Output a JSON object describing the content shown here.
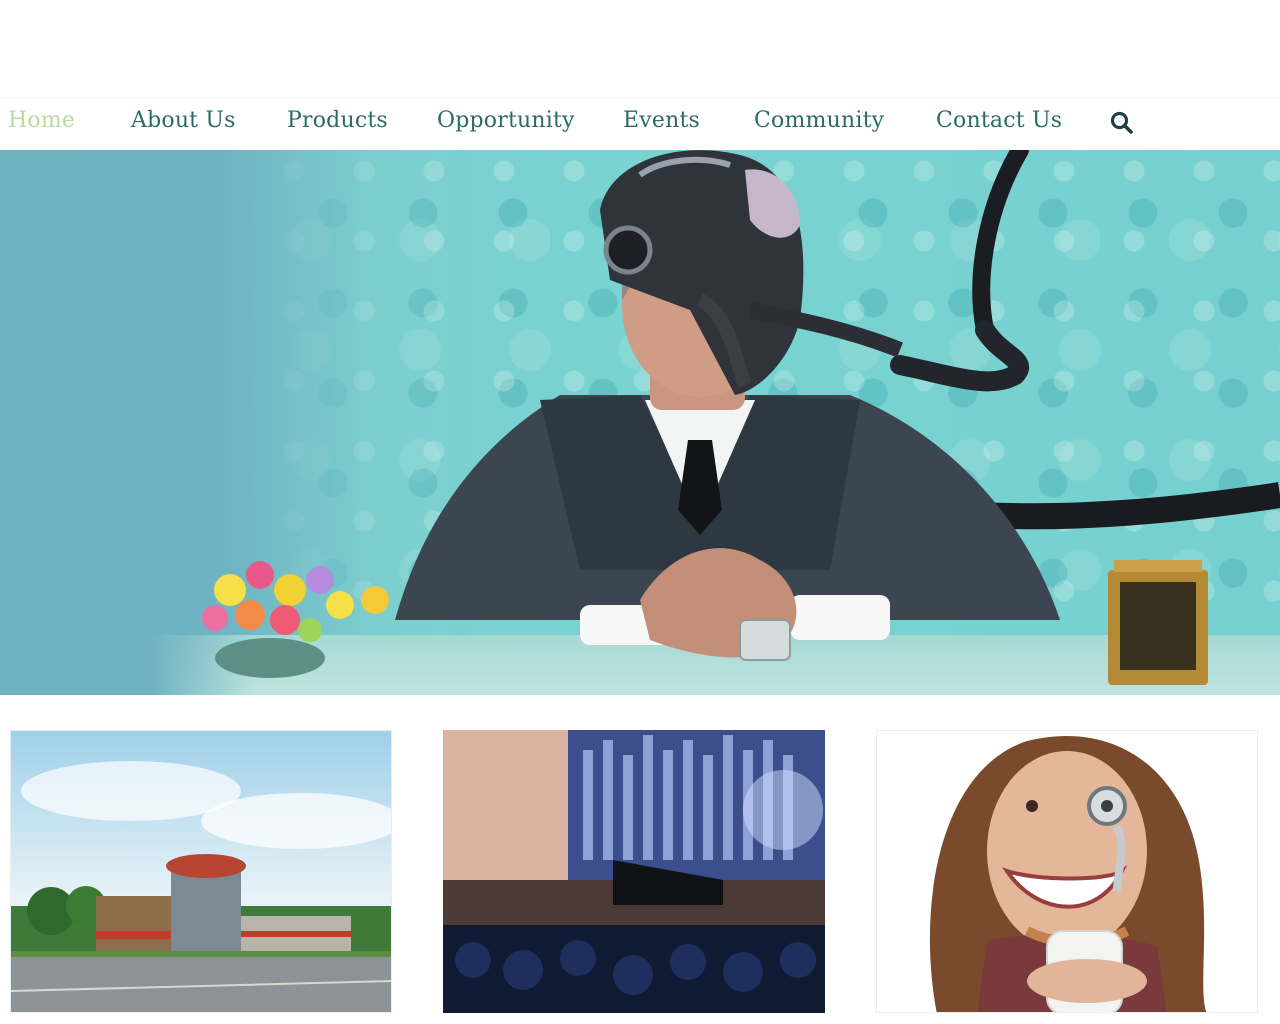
{
  "nav": {
    "items": [
      {
        "label": "Home",
        "active": true
      },
      {
        "label": "About Us",
        "active": false
      },
      {
        "label": "Products",
        "active": false
      },
      {
        "label": "Opportunity",
        "active": false
      },
      {
        "label": "Events",
        "active": false
      },
      {
        "label": "Community",
        "active": false
      },
      {
        "label": "Contact Us",
        "active": false
      }
    ],
    "search_icon": "search-icon"
  },
  "colors": {
    "nav_text": "#2b6b62",
    "nav_active": "#b5dd9c",
    "hero_bg": "#76d0cf",
    "hero_left": "#6fb2c0"
  },
  "hero": {
    "image": "hero-banner-image"
  },
  "thumbnails": [
    {
      "image": "headquarters-building-photo"
    },
    {
      "image": "concert-hall-orchestra-photo"
    },
    {
      "image": "smiling-woman-with-mug-photo"
    }
  ]
}
